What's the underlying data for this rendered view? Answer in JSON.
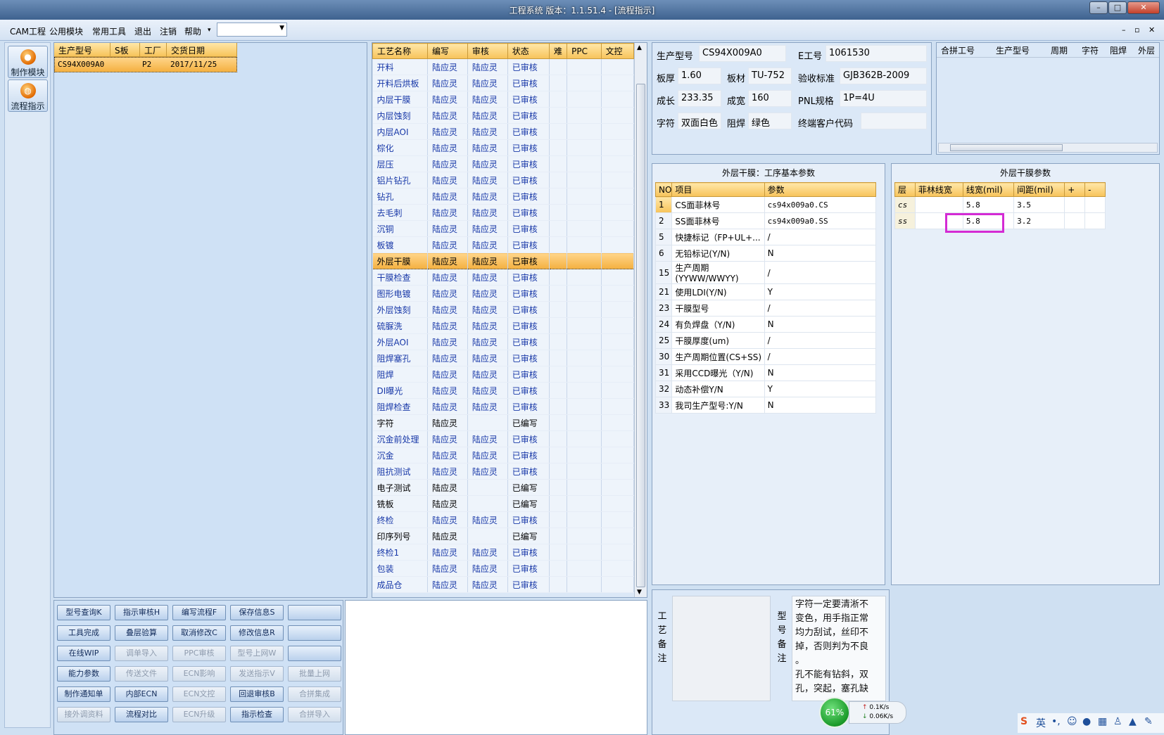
{
  "window": {
    "title": "工程系统    版本：1.1.51.4 - [流程指示]",
    "controls": [
      "–",
      "□",
      "✕"
    ],
    "mdi_controls": [
      "–",
      "▫",
      "✕"
    ]
  },
  "menu": {
    "items": [
      "CAM工程",
      "公用模块",
      "常用工具",
      "退出",
      "注销",
      "帮助"
    ],
    "help_arrow": "▾",
    "combo_value": ""
  },
  "left_tools": [
    {
      "label": "制作模块",
      "icon": "fire-icon"
    },
    {
      "label": "流程指示",
      "icon": "flow-icon"
    }
  ],
  "orders": {
    "headers": [
      "生产型号",
      "S板",
      "工厂",
      "交货日期"
    ],
    "rows": [
      {
        "model": "CS94X009A0",
        "s_board": "",
        "factory": "P2",
        "delivery": "2017/11/25"
      }
    ]
  },
  "process": {
    "headers": [
      "工艺名称",
      "编写",
      "审核",
      "状态",
      "难",
      "PPC",
      "文控"
    ],
    "selected_index": 12,
    "rows": [
      [
        "开料",
        "陆应灵",
        "陆应灵",
        "已审核"
      ],
      [
        "开料后烘板",
        "陆应灵",
        "陆应灵",
        "已审核"
      ],
      [
        "内层干膜",
        "陆应灵",
        "陆应灵",
        "已审核"
      ],
      [
        "内层蚀刻",
        "陆应灵",
        "陆应灵",
        "已审核"
      ],
      [
        "内层AOI",
        "陆应灵",
        "陆应灵",
        "已审核"
      ],
      [
        "棕化",
        "陆应灵",
        "陆应灵",
        "已审核"
      ],
      [
        "层压",
        "陆应灵",
        "陆应灵",
        "已审核"
      ],
      [
        "铝片钻孔",
        "陆应灵",
        "陆应灵",
        "已审核"
      ],
      [
        "钻孔",
        "陆应灵",
        "陆应灵",
        "已审核"
      ],
      [
        "去毛刺",
        "陆应灵",
        "陆应灵",
        "已审核"
      ],
      [
        "沉铜",
        "陆应灵",
        "陆应灵",
        "已审核"
      ],
      [
        "板镀",
        "陆应灵",
        "陆应灵",
        "已审核"
      ],
      [
        "外层干膜",
        "陆应灵",
        "陆应灵",
        "已审核"
      ],
      [
        "干膜检查",
        "陆应灵",
        "陆应灵",
        "已审核"
      ],
      [
        "图形电镀",
        "陆应灵",
        "陆应灵",
        "已审核"
      ],
      [
        "外层蚀刻",
        "陆应灵",
        "陆应灵",
        "已审核"
      ],
      [
        "硫脲洗",
        "陆应灵",
        "陆应灵",
        "已审核"
      ],
      [
        "外层AOI",
        "陆应灵",
        "陆应灵",
        "已审核"
      ],
      [
        "阻焊塞孔",
        "陆应灵",
        "陆应灵",
        "已审核"
      ],
      [
        "阻焊",
        "陆应灵",
        "陆应灵",
        "已审核"
      ],
      [
        "DI曝光",
        "陆应灵",
        "陆应灵",
        "已审核"
      ],
      [
        "阻焊检查",
        "陆应灵",
        "陆应灵",
        "已审核"
      ],
      [
        "字符",
        "陆应灵",
        "",
        "已编写"
      ],
      [
        "沉金前处理",
        "陆应灵",
        "陆应灵",
        "已审核"
      ],
      [
        "沉金",
        "陆应灵",
        "陆应灵",
        "已审核"
      ],
      [
        "阻抗测试",
        "陆应灵",
        "陆应灵",
        "已审核"
      ],
      [
        "电子测试",
        "陆应灵",
        "",
        "已编写"
      ],
      [
        "铣板",
        "陆应灵",
        "",
        "已编写"
      ],
      [
        "终检",
        "陆应灵",
        "陆应灵",
        "已审核"
      ],
      [
        "印序列号",
        "陆应灵",
        "",
        "已编写"
      ],
      [
        "终检1",
        "陆应灵",
        "陆应灵",
        "已审核"
      ],
      [
        "包装",
        "陆应灵",
        "陆应灵",
        "已审核"
      ],
      [
        "成品仓",
        "陆应灵",
        "陆应灵",
        "已审核"
      ]
    ]
  },
  "info": {
    "model_label": "生产型号",
    "model": "CS94X009A0",
    "eno_label": "E工号",
    "eno": "1061530",
    "thick_label": "板厚",
    "thick": "1.60",
    "material_label": "板材",
    "material": "TU-752",
    "standard_label": "验收标准",
    "standard": "GJB362B-2009",
    "grow_label": "成长",
    "grow": "233.35",
    "width_label": "成宽",
    "width": "160",
    "pnl_label": "PNL规格",
    "pnl": "1P=4U",
    "char_label": "字符",
    "char": "双面白色",
    "mask_label": "阻焊",
    "mask": "绿色",
    "cust_label": "终端客户代码",
    "cust": ""
  },
  "pin_table": {
    "headers": [
      "合拼工号",
      "生产型号",
      "周期",
      "字符",
      "阻焊",
      "外层"
    ]
  },
  "basic_params": {
    "title": "外层干膜：工序基本参数",
    "headers": [
      "NO",
      "项目",
      "参数"
    ],
    "rows": [
      [
        "1",
        "CS面菲林号",
        "cs94x009a0.CS"
      ],
      [
        "2",
        "SS面菲林号",
        "cs94x009a0.SS"
      ],
      [
        "5",
        "快捷标记（FP+UL+...",
        "/"
      ],
      [
        "6",
        "无铅标记(Y/N)",
        "N"
      ],
      [
        "15",
        "生产周期(YYWW/WWYY)",
        "/"
      ],
      [
        "21",
        "使用LDI(Y/N)",
        "Y"
      ],
      [
        "23",
        "干膜型号",
        "/"
      ],
      [
        "24",
        "有负焊盘（Y/N)",
        "N"
      ],
      [
        "25",
        "干膜厚度(um)",
        "/"
      ],
      [
        "30",
        "生产周期位置(CS+SS)",
        "/"
      ],
      [
        "31",
        "采用CCD曝光（Y/N)",
        "N"
      ],
      [
        "32",
        "动态补偿Y/N",
        "Y"
      ],
      [
        "33",
        "我司生产型号:Y/N",
        "N"
      ]
    ]
  },
  "dryfilm_params": {
    "title": "外层干膜参数",
    "headers": [
      "层",
      "菲林线宽",
      "线宽(mil)",
      "间距(mil)",
      "+",
      "-"
    ],
    "rows": [
      [
        "cs",
        "",
        "5.8",
        "3.5",
        "",
        ""
      ],
      [
        "ss",
        "",
        "5.8",
        "3.2",
        "",
        ""
      ]
    ]
  },
  "buttons": [
    [
      {
        "label": "型号查询K",
        "enabled": true
      },
      {
        "label": "指示审核H",
        "enabled": true
      },
      {
        "label": "编写流程F",
        "enabled": true
      },
      {
        "label": "保存信息S",
        "enabled": true
      },
      {
        "label": "",
        "enabled": true
      }
    ],
    [
      {
        "label": "工具完成",
        "enabled": true
      },
      {
        "label": "叠层验算",
        "enabled": true
      },
      {
        "label": "取消修改C",
        "enabled": true
      },
      {
        "label": "修改信息R",
        "enabled": true
      },
      {
        "label": "",
        "enabled": true
      }
    ],
    [
      {
        "label": "在线WIP",
        "enabled": true
      },
      {
        "label": "调单导入",
        "enabled": false
      },
      {
        "label": "PPC审核",
        "enabled": false
      },
      {
        "label": "型号上网W",
        "enabled": false
      },
      {
        "label": "",
        "enabled": true
      }
    ],
    [
      {
        "label": "能力参数",
        "enabled": true
      },
      {
        "label": "传送文件",
        "enabled": false
      },
      {
        "label": "ECN影响",
        "enabled": false
      },
      {
        "label": "发送指示V",
        "enabled": false
      },
      {
        "label": "批量上网",
        "enabled": false
      }
    ],
    [
      {
        "label": "制作通知单",
        "enabled": true
      },
      {
        "label": "内部ECN",
        "enabled": true
      },
      {
        "label": "ECN文控",
        "enabled": false
      },
      {
        "label": "回退审核B",
        "enabled": true
      },
      {
        "label": "合拼集成",
        "enabled": false
      }
    ],
    [
      {
        "label": "接外调资料",
        "enabled": false
      },
      {
        "label": "流程对比",
        "enabled": true
      },
      {
        "label": "ECN升级",
        "enabled": false
      },
      {
        "label": "指示检查",
        "enabled": true
      },
      {
        "label": "合拼导入",
        "enabled": false
      }
    ]
  ],
  "notes": {
    "process_label": "工艺备注",
    "model_label": "型号备注",
    "process_note": "",
    "model_note_lines": [
      "字符一定要清淅不",
      "变色，用手指正常",
      "均力刮试，丝印不",
      "掉，否则判为不良",
      "。",
      "孔不能有钻斜，双",
      "孔，突起，塞孔缺"
    ]
  },
  "net_widget": {
    "percent": "61%",
    "up": "0.1K/s",
    "down": "0.06K/s",
    "up_arrow": "↑",
    "down_arrow": "↓"
  },
  "tray": {
    "ime_label": "英"
  }
}
